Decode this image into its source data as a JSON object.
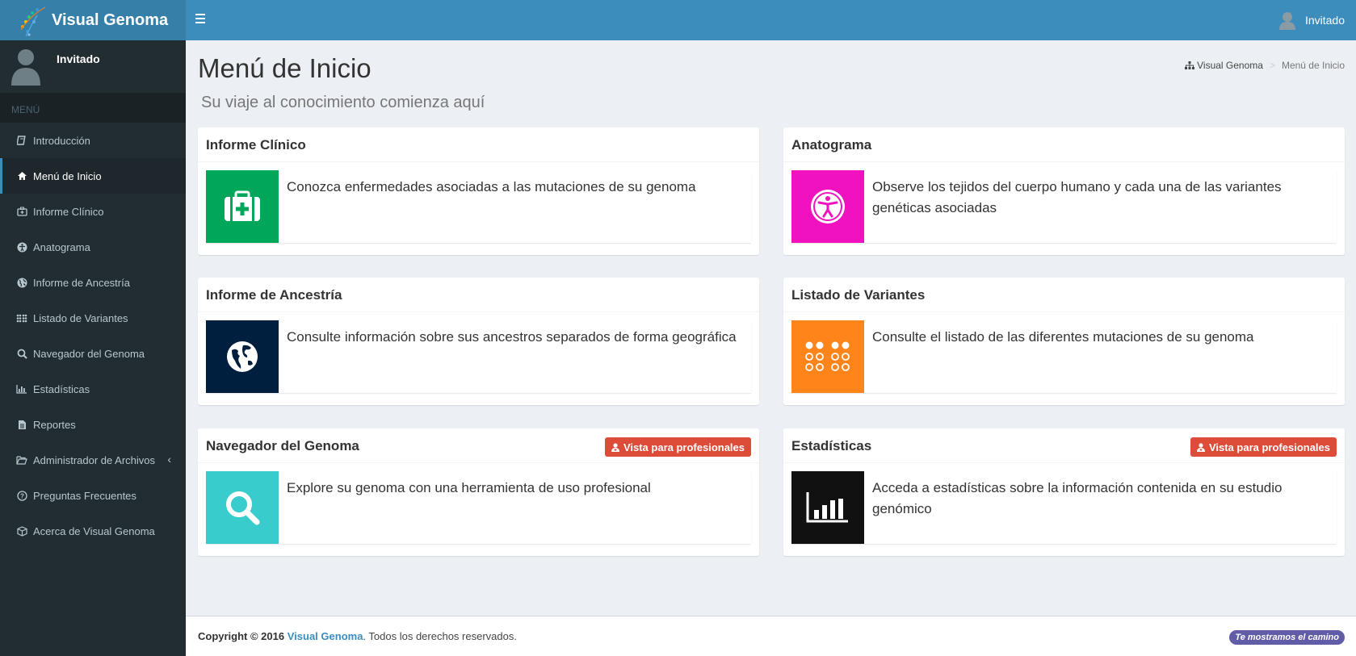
{
  "header": {
    "app_title": "Visual Genoma",
    "user_name": "Invitado"
  },
  "sidebar": {
    "user_name": "Invitado",
    "menu_header": "MENÚ",
    "items": [
      {
        "label": "Introducción",
        "icon": "book-icon"
      },
      {
        "label": "Menú de Inicio",
        "icon": "home-icon",
        "active": true
      },
      {
        "label": "Informe Clínico",
        "icon": "medkit-icon"
      },
      {
        "label": "Anatograma",
        "icon": "universal-access-icon"
      },
      {
        "label": "Informe de Ancestría",
        "icon": "globe-icon"
      },
      {
        "label": "Listado de Variantes",
        "icon": "dots-grid-icon"
      },
      {
        "label": "Navegador del Genoma",
        "icon": "search-icon"
      },
      {
        "label": "Estadísticas",
        "icon": "bar-chart-icon"
      },
      {
        "label": "Reportes",
        "icon": "file-icon"
      },
      {
        "label": "Administrador de Archivos",
        "icon": "folder-open-icon"
      },
      {
        "label": "Preguntas Frecuentes",
        "icon": "question-circle-icon"
      },
      {
        "label": "Acerca de Visual Genoma",
        "icon": "cube-icon"
      }
    ]
  },
  "page": {
    "title": "Menú de Inicio",
    "subtitle": "Su viaje al conocimiento comienza aquí"
  },
  "breadcrumb": {
    "root": "Visual Genoma",
    "current": "Menú de Inicio"
  },
  "cards": {
    "clinico": {
      "title": "Informe Clínico",
      "text": "Conozca enfermedades asociadas a las mutaciones de su genoma",
      "color": "#00a65a",
      "icon": "medkit-icon"
    },
    "anatograma": {
      "title": "Anatograma",
      "text": "Observe los tejidos del cuerpo humano y cada una de las variantes genéticas asociadas",
      "color": "#f012be",
      "icon": "universal-access-icon"
    },
    "ancestria": {
      "title": "Informe de Ancestría",
      "text": "Consulte información sobre sus ancestros separados de forma geográfica",
      "color": "#001f3f",
      "icon": "globe-icon"
    },
    "variantes": {
      "title": "Listado de Variantes",
      "text": "Consulte el listado de las diferentes mutaciones de su genoma",
      "color": "#ff851b",
      "icon": "dots-grid-icon"
    },
    "navegador": {
      "title": "Navegador del Genoma",
      "text": "Explore su genoma con una herramienta de uso profesional",
      "color": "#39cccc",
      "icon": "search-icon",
      "button": "Vista para profesionales"
    },
    "estadisticas": {
      "title": "Estadísticas",
      "text": "Acceda a estadísticas sobre la información contenida en su estudio genómico",
      "color": "#111111",
      "icon": "bar-chart-icon",
      "button": "Vista para profesionales"
    }
  },
  "footer": {
    "copyright": "Copyright © 2016",
    "brand": "Visual Genoma",
    "rights": ". Todos los derechos reservados.",
    "badge": "Te mostramos el camino"
  }
}
